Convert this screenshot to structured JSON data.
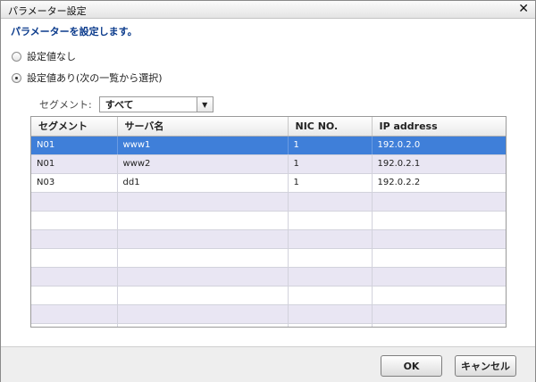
{
  "window": {
    "title": "パラメーター設定",
    "close_glyph": "✕"
  },
  "heading": "パラメーターを設定します。",
  "options": [
    {
      "label": "設定値なし",
      "checked": false
    },
    {
      "label": "設定値あり(次の一覧から選択)",
      "checked": true
    }
  ],
  "segment": {
    "label": "セグメント:",
    "value": "すべて",
    "arrow_glyph": "▼"
  },
  "table": {
    "columns": [
      "セグメント",
      "サーバ名",
      "NIC NO.",
      "IP address"
    ],
    "rows": [
      [
        "N01",
        "www1",
        "1",
        "192.0.2.0"
      ],
      [
        "N01",
        "www2",
        "1",
        "192.0.2.1"
      ],
      [
        "N03",
        "dd1",
        "1",
        "192.0.2.2"
      ]
    ],
    "selected_row": 0,
    "empty_rows": 8
  },
  "buttons": {
    "ok": "OK",
    "cancel": "キャンセル"
  },
  "colors": {
    "selection": "#3f7fd9",
    "heading": "#0b3b8c",
    "row_alt": "#e9e6f3"
  }
}
